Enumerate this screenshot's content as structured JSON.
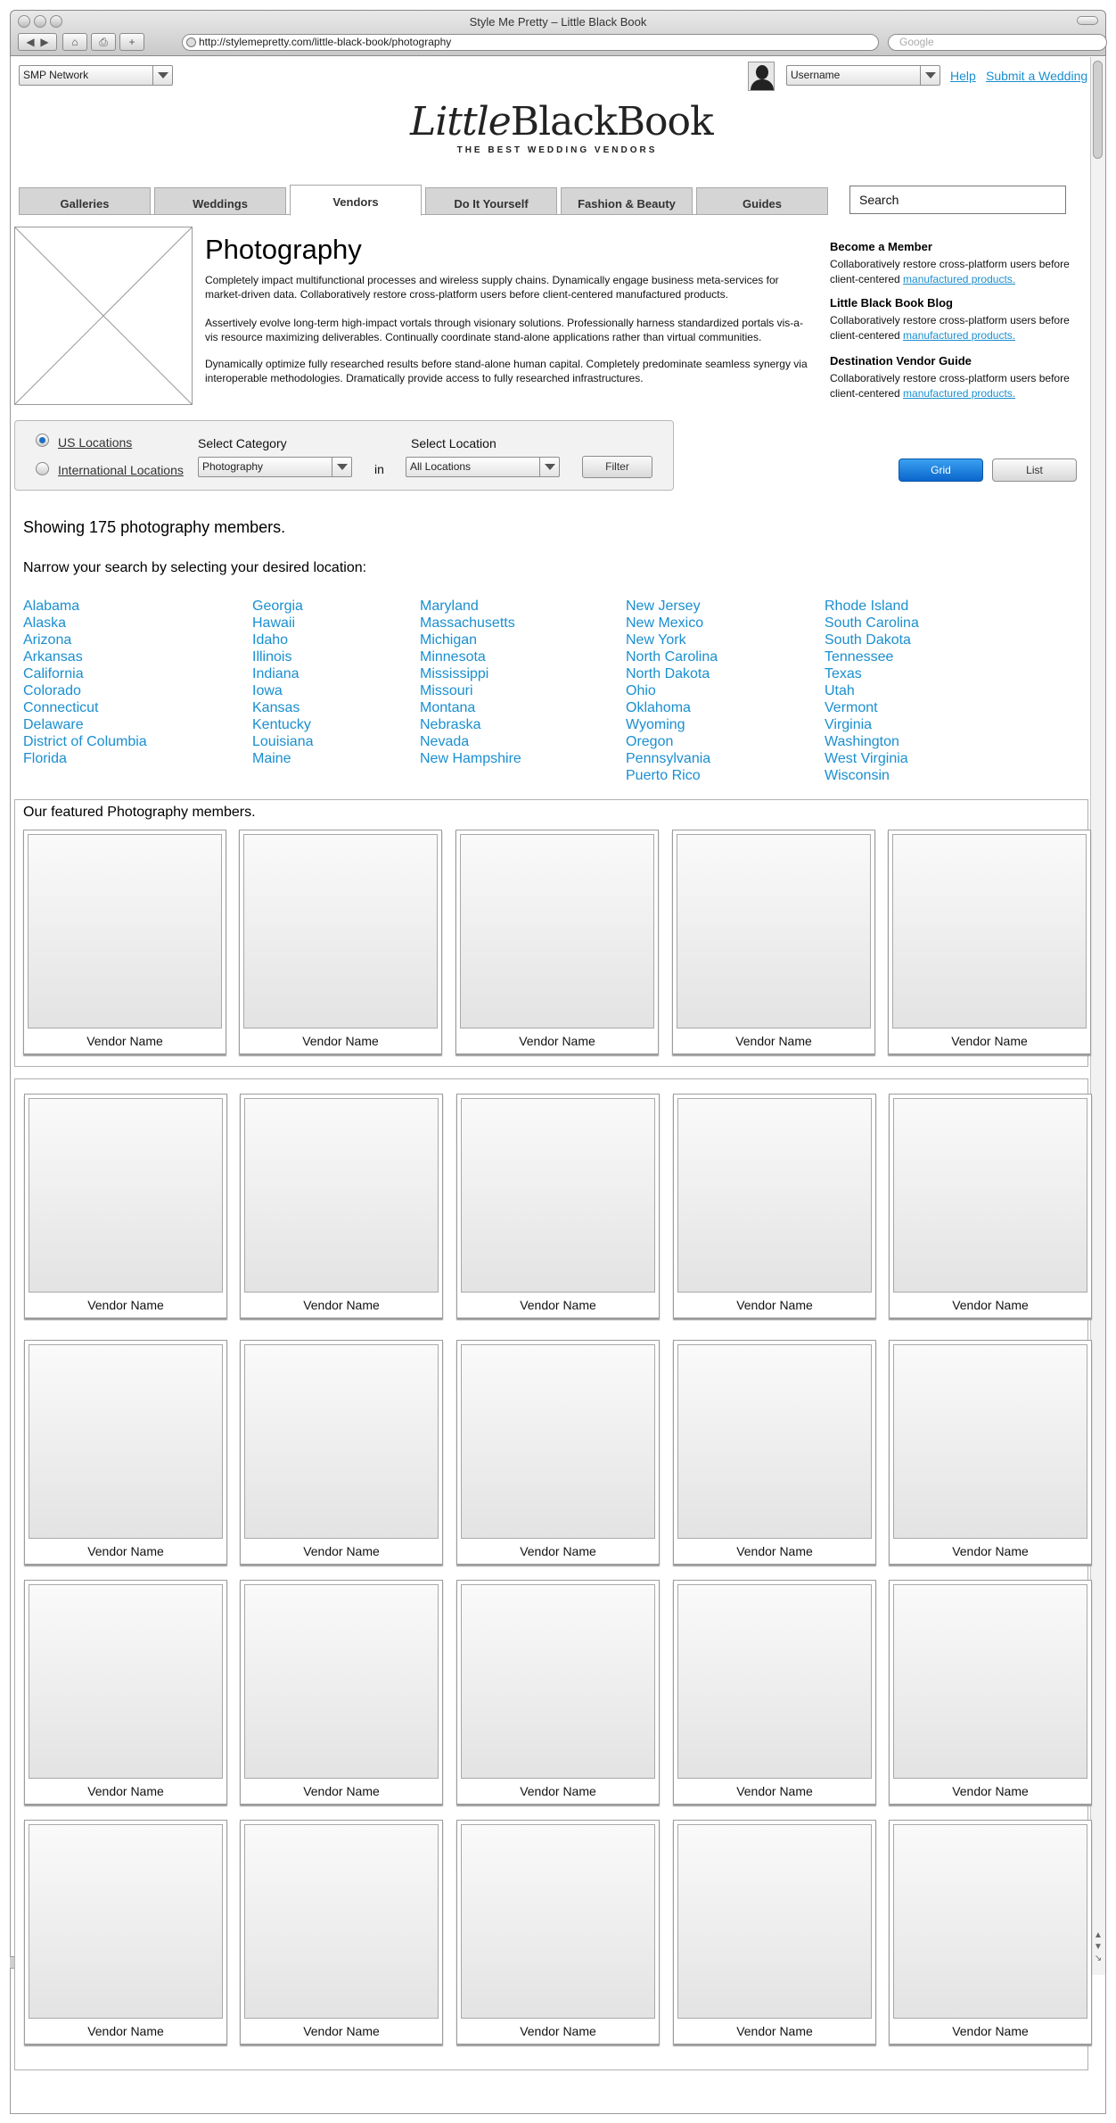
{
  "window": {
    "title": "Style Me Pretty – Little Black Book",
    "url": "http://stylemepretty.com/little-black-book/photography",
    "search_placeholder": "Google"
  },
  "top": {
    "network_select": "SMP Network",
    "username_select": "Username",
    "help": "Help",
    "submit": "Submit a Wedding"
  },
  "logo": {
    "little": "Little",
    "black_book": "BlackBook",
    "tagline": "THE BEST WEDDING VENDORS"
  },
  "nav": {
    "tabs": [
      "Galleries",
      "Weddings",
      "Vendors",
      "Do It Yourself",
      "Fashion & Beauty",
      "Guides"
    ],
    "active": "Vendors",
    "search_value": "Search"
  },
  "main": {
    "heading": "Photography",
    "paragraphs": [
      "Completely impact multifunctional processes and wireless supply chains. Dynamically engage business meta-services for market-driven data. Collaboratively restore cross-platform users before client-centered manufactured products.",
      "Assertively evolve long-term high-impact vortals through visionary solutions. Professionally harness standardized portals vis-a-vis resource maximizing deliverables. Continually coordinate stand-alone applications rather than virtual communities.",
      "Dynamically optimize fully researched results before stand-alone human capital. Completely predominate seamless synergy via interoperable methodologies. Dramatically provide access to fully researched infrastructures."
    ]
  },
  "sidebar": {
    "blocks": [
      {
        "title": "Become a Member",
        "text": "Collaboratively restore cross-platform users before client-centered ",
        "link": "manufactured products."
      },
      {
        "title": "Little Black Book Blog",
        "text": "Collaboratively restore cross-platform users before client-centered ",
        "link": "manufactured products."
      },
      {
        "title": "Destination Vendor Guide",
        "text": "Collaboratively restore cross-platform users before client-centered ",
        "link": "manufactured products."
      }
    ]
  },
  "filter": {
    "us_label": "US Locations",
    "intl_label": "International Locations",
    "selected_region": "US Locations",
    "category_caption": "Select Category",
    "category_value": "Photography",
    "in_word": "in",
    "location_caption": "Select Location",
    "location_value": "All Locations",
    "filter_button": "Filter"
  },
  "view": {
    "grid": "Grid",
    "list": "List",
    "active": "Grid"
  },
  "results": {
    "showing": "Showing 175 photography members.",
    "narrow": "Narrow your search by selecting your desired location:"
  },
  "locations": [
    [
      "Alabama",
      "Alaska",
      "Arizona",
      "Arkansas",
      "California",
      "Colorado",
      "Connecticut",
      "Delaware",
      "District of Columbia",
      "Florida"
    ],
    [
      "Georgia",
      "Hawaii",
      "Idaho",
      "Illinois",
      "Indiana",
      "Iowa",
      "Kansas",
      "Kentucky",
      "Louisiana",
      "Maine"
    ],
    [
      "Maryland",
      "Massachusetts",
      "Michigan",
      "Minnesota",
      "Mississippi",
      "Missouri",
      "Montana",
      "Nebraska",
      "Nevada",
      "New Hampshire"
    ],
    [
      "New Jersey",
      "New Mexico",
      "New York",
      "North Carolina",
      "North Dakota",
      "Ohio",
      "Oklahoma",
      "Wyoming",
      "Oregon",
      "Pennsylvania",
      "Puerto Rico"
    ],
    [
      "Rhode Island",
      "South Carolina",
      "South Dakota",
      "Tennessee",
      "Texas",
      "Utah",
      "Vermont",
      "Virginia",
      "Washington",
      "West Virginia",
      "Wisconsin"
    ]
  ],
  "featured": {
    "heading": "Our featured Photography members.",
    "vendors": [
      "Vendor Name",
      "Vendor Name",
      "Vendor Name",
      "Vendor Name",
      "Vendor Name"
    ]
  },
  "grid_vendors": [
    [
      "Vendor Name",
      "Vendor Name",
      "Vendor Name",
      "Vendor Name",
      "Vendor Name"
    ],
    [
      "Vendor Name",
      "Vendor Name",
      "Vendor Name",
      "Vendor Name",
      "Vendor Name"
    ],
    [
      "Vendor Name",
      "Vendor Name",
      "Vendor Name",
      "Vendor Name",
      "Vendor Name"
    ],
    [
      "Vendor Name",
      "Vendor Name",
      "Vendor Name",
      "Vendor Name",
      "Vendor Name"
    ]
  ],
  "colors": {
    "link": "#1a8fd0",
    "grid_button": "#0a66cc",
    "tab_inactive": "#d5d5d5"
  }
}
